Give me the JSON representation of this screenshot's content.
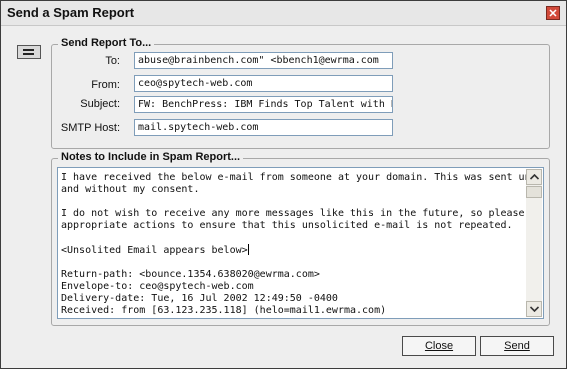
{
  "window": {
    "title": "Send a Spam Report",
    "close_glyph": "✕"
  },
  "icons": {
    "report": "report-icon",
    "close": "close-icon"
  },
  "send_report": {
    "title": "Send Report To...",
    "to_label": "To:",
    "to_value": "abuse@brainbench.com\" <bbench1@ewrma.com",
    "from_label": "From:",
    "from_value": "ceo@spytech-web.com",
    "subject_label": "Subject:",
    "subject_value": "FW: BenchPress:  IBM Finds Top Talent with Brain",
    "smtp_label": "SMTP Host:",
    "smtp_value": "mail.spytech-web.com"
  },
  "notes": {
    "title": "Notes to Include in Spam Report...",
    "lines": [
      "I have received the below e-mail from someone at your domain. This was sent unsolicited",
      "and without my consent.",
      "",
      "I do not wish to receive any more messages like this in the future, so please take the",
      "appropriate actions to ensure that this unsolicited e-mail is not repeated.",
      "",
      "<Unsolited Email appears below>",
      "",
      "Return-path: <bounce.1354.638020@ewrma.com>",
      "Envelope-to: ceo@spytech-web.com",
      "Delivery-date: Tue, 16 Jul 2002 12:49:50 -0400",
      "Received: from [63.123.235.118] (helo=mail1.ewrma.com)"
    ]
  },
  "buttons": {
    "close_label": "Close",
    "send_label": "Send"
  }
}
